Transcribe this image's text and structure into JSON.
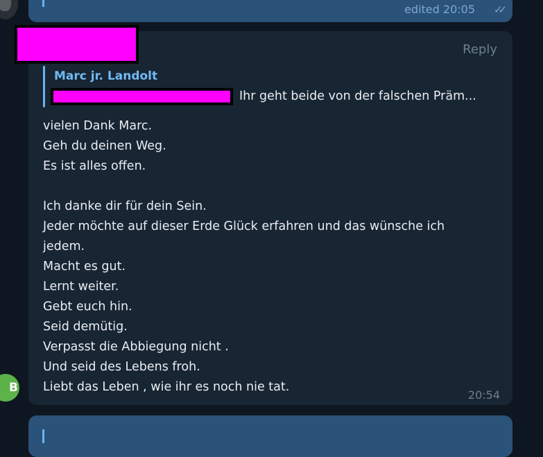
{
  "prev_message": {
    "edited_label": "edited 20:05",
    "status_icon": "double-check-icon"
  },
  "message": {
    "reply_label": "Reply",
    "quote": {
      "author": "Marc jr. Landolt",
      "text": "Ihr geht beide von der falschen Präm..."
    },
    "lines": [
      "vielen Dank Marc.",
      "Geh du deinen Weg.",
      "Es ist alles offen.",
      "",
      "Ich danke dir für dein Sein.",
      "Jeder möchte auf dieser Erde Glück erfahren und das wünsche ich",
      "jedem.",
      "Macht es gut.",
      "Lernt weiter.",
      "Gebt euch hin.",
      "Seid demütig.",
      "Verpasst die Abbiegung nicht .",
      "Und seid des Lebens froh.",
      "Liebt das Leben , wie ihr es noch nie tat."
    ],
    "time": "20:54"
  },
  "sender_avatar": {
    "letter": "B",
    "color": "#5cb34a"
  },
  "colors": {
    "background": "#0e1621",
    "incoming_bubble": "#182533",
    "outgoing_bubble": "#2b5278",
    "accent": "#6ab3f3"
  }
}
